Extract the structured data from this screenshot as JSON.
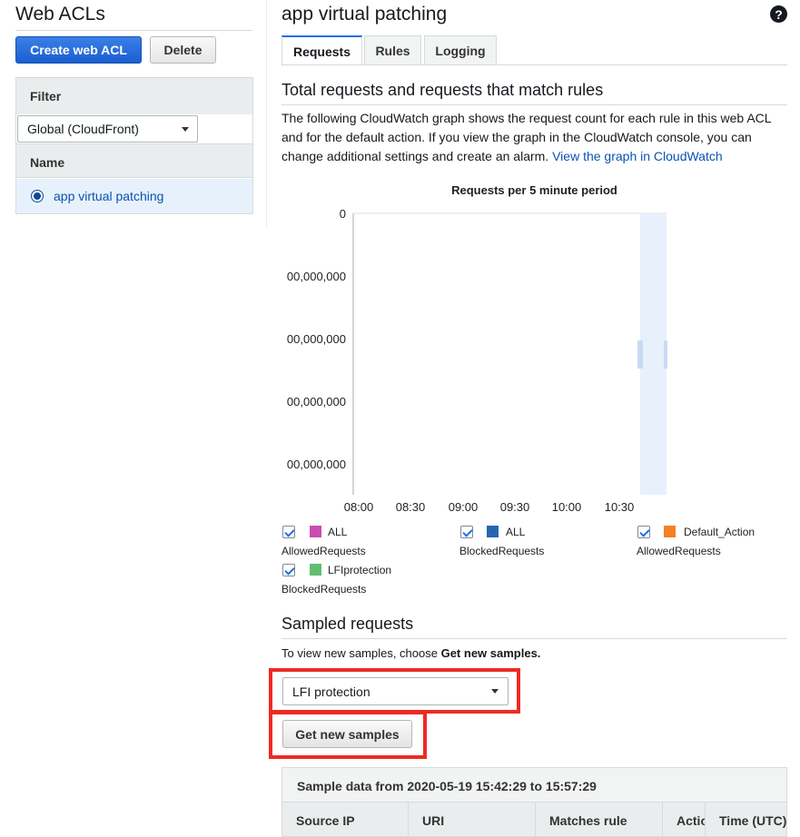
{
  "left": {
    "title": "Web ACLs",
    "create_button": "Create web ACL",
    "delete_button": "Delete",
    "filter_label": "Filter",
    "filter_value": "Global (CloudFront)",
    "name_header": "Name",
    "acls": [
      {
        "name": "app virtual patching",
        "selected": true
      }
    ]
  },
  "main": {
    "title": "app virtual patching",
    "help_icon": "?",
    "tabs": [
      {
        "label": "Requests",
        "active": true
      },
      {
        "label": "Rules",
        "active": false
      },
      {
        "label": "Logging",
        "active": false
      }
    ],
    "section_title": "Total requests and requests that match rules",
    "description": "The following CloudWatch graph shows the request count for each rule in this web ACL and for the default action. If you view the graph in the CloudWatch console, you can change additional settings and create an alarm.",
    "cloudwatch_link": "View the graph in CloudWatch"
  },
  "chart_data": {
    "type": "line",
    "title": "Requests per 5 minute period",
    "y_tick_labels": [
      "0",
      "00,000,000",
      "00,000,000",
      "00,000,000",
      "00,000,000"
    ],
    "x_tick_labels": [
      "08:00",
      "08:30",
      "09:00",
      "09:30",
      "10:00",
      "10:30"
    ],
    "grid": false,
    "series": [
      {
        "name": "ALL AllowedRequests",
        "color": "#c94db2",
        "checked": true
      },
      {
        "name": "ALL BlockedRequests",
        "color": "#1f5da8",
        "checked": true
      },
      {
        "name": "Default_Action AllowedRequests",
        "color": "#f58025",
        "checked": true
      },
      {
        "name": "LFIprotection BlockedRequests",
        "color": "#62bd6e",
        "checked": true
      }
    ]
  },
  "legend": [
    {
      "line1": "ALL",
      "line2": "AllowedRequests",
      "color": "#c94db2"
    },
    {
      "line1": "ALL",
      "line2": "BlockedRequests",
      "color": "#2765b0"
    },
    {
      "line1": "Default_Action",
      "line2": "AllowedRequests",
      "color": "#f58025"
    },
    {
      "line1": "LFIprotection",
      "line2": "BlockedRequests",
      "color": "#62bd6e"
    }
  ],
  "sampled": {
    "title": "Sampled requests",
    "instruction_prefix": "To view new samples, choose ",
    "instruction_bold": "Get new samples.",
    "rule_select": "LFI protection",
    "get_button": "Get new samples",
    "table_caption": "Sample data from 2020-05-19 15:42:29 to 15:57:29",
    "columns": [
      "Source IP",
      "URI",
      "Matches rule",
      "Action",
      "Time (UTC)"
    ]
  }
}
